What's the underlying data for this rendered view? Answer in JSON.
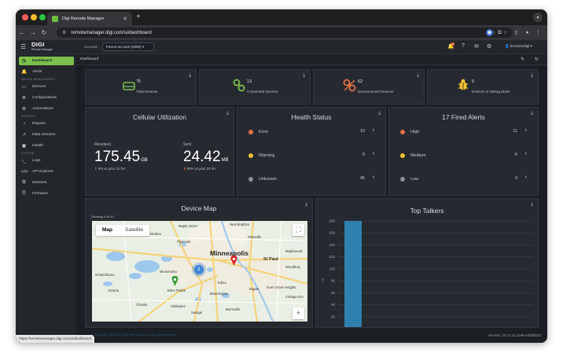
{
  "browser": {
    "tab_title": "Digi Remote Manager",
    "url": "remotemanager.digi.com/ui/dashboard",
    "status_url": "https://remotemanager.digi.com/ui/dashboard"
  },
  "header": {
    "logo": "DIGI",
    "logo_sub": "Remote Manager",
    "account_label": "Account:",
    "account_value": "Parent account (2899)",
    "user": "brucknerdigi"
  },
  "sidebar": {
    "items": [
      {
        "label": "Dashboard",
        "icon": "dashboard-icon"
      },
      {
        "label": "Alerts",
        "icon": "bell-icon"
      },
      {
        "label": "Devices",
        "icon": "device-icon"
      },
      {
        "label": "Configurations",
        "icon": "gear-icon"
      },
      {
        "label": "Automations",
        "icon": "automation-icon"
      },
      {
        "label": "Reports",
        "icon": "pie-icon"
      },
      {
        "label": "Data Streams",
        "icon": "chart-icon"
      },
      {
        "label": "Health",
        "icon": "health-icon"
      },
      {
        "label": "Logs",
        "icon": "terminal-icon"
      },
      {
        "label": "API Explorer",
        "icon": "code-icon"
      },
      {
        "label": "Monitors",
        "icon": "monitor-icon"
      },
      {
        "label": "Firmware",
        "icon": "firmware-icon"
      }
    ],
    "sections": [
      "DEVICE MANAGEMENT",
      "INSIGHTS",
      "SYSTEM"
    ]
  },
  "breadcrumb": "Dashboard",
  "stats": [
    {
      "value": "75",
      "label": "Total Devices",
      "color": "#7bc04a"
    },
    {
      "value": "13",
      "label": "Connected Devices",
      "color": "#7bc04a"
    },
    {
      "value": "62",
      "label": "Disconnected Devices",
      "color": "#e8704a"
    },
    {
      "value": "0",
      "label": "Devices in Debug Mode",
      "color": "#f2c230"
    }
  ],
  "cellular": {
    "title": "Cellular Utilization",
    "received_label": "Received",
    "received_value": "175.45",
    "received_unit": "GB",
    "received_delta": "5% vs prior 24 hrs",
    "sent_label": "Sent",
    "sent_value": "24.42",
    "sent_unit": "MB",
    "sent_delta": "60% vs prior 24 hrs"
  },
  "health": {
    "title": "Health Status",
    "rows": [
      {
        "label": "Error",
        "value": "10",
        "color": "#e8704a"
      },
      {
        "label": "Warning",
        "value": "0",
        "color": "#f2c230"
      },
      {
        "label": "Unknown",
        "value": "45",
        "color": "#8a8f95"
      }
    ]
  },
  "alerts": {
    "title": "17 Fired Alerts",
    "rows": [
      {
        "label": "High",
        "value": "11",
        "color": "#e8704a"
      },
      {
        "label": "Medium",
        "value": "6",
        "color": "#f2c230"
      },
      {
        "label": "Low",
        "value": "0",
        "color": "#8a8f95"
      }
    ]
  },
  "device_map": {
    "title": "Device Map",
    "showing": "Showing 8 of 10",
    "tab_map": "Map",
    "tab_satellite": "Satellite",
    "cities": [
      "Minneapolis",
      "St Paul",
      "Plymouth",
      "Medina",
      "Maple Grove",
      "New Brighton",
      "Roseville",
      "Minnetonka",
      "Edina",
      "Bloomington",
      "Eden Prairie",
      "Burnsville",
      "Shakopee",
      "Chaska",
      "Victoria",
      "Prior Lake",
      "Savage",
      "Eagan",
      "Inver Grove Heights",
      "Cottage Gro",
      "Mahtomedi",
      "Woodbury",
      "Maplewood",
      "St Bonifacius",
      "Lakeville",
      "Orono"
    ],
    "cluster_count": "6"
  },
  "top_talkers": {
    "title": "Top Talkers"
  },
  "chart_data": {
    "type": "bar",
    "title": "Top Talkers",
    "categories": [
      ""
    ],
    "values": [
      180
    ],
    "ylabel": "GB",
    "ylim": [
      0,
      180
    ],
    "yticks": [
      180,
      160,
      140,
      120,
      100,
      80,
      60,
      40,
      20
    ],
    "color": "#2f7fb0"
  },
  "footer": {
    "copyright": "© Copyright 1996-2024 Digi International Inc. All rights reserved.",
    "version": "Version: 23.12.11.1195-a4f3fd233"
  }
}
